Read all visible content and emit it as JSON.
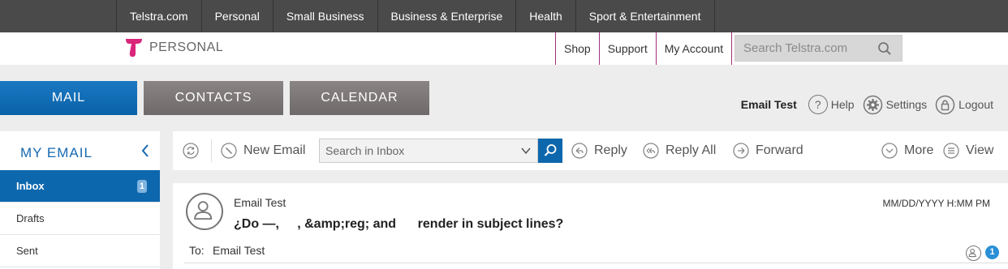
{
  "global_nav": {
    "items": [
      "Telstra.com",
      "Personal",
      "Small Business",
      "Business & Enterprise",
      "Health",
      "Sport & Entertainment"
    ]
  },
  "header": {
    "brand": "PERSONAL",
    "links": [
      "Shop",
      "Support",
      "My Account"
    ],
    "search_placeholder": "Search Telstra.com"
  },
  "tabs": [
    "MAIL",
    "CONTACTS",
    "CALENDAR"
  ],
  "user": {
    "name": "Email Test",
    "help": "Help",
    "settings": "Settings",
    "logout": "Logout"
  },
  "sidebar": {
    "title": "MY EMAIL",
    "items": [
      {
        "label": "Inbox",
        "count": "1"
      },
      {
        "label": "Drafts"
      },
      {
        "label": "Sent"
      }
    ]
  },
  "toolbar": {
    "new_email": "New Email",
    "search_placeholder": "Search in Inbox",
    "reply": "Reply",
    "reply_all": "Reply All",
    "forward": "Forward",
    "more": "More",
    "view": "View"
  },
  "message": {
    "from": "Email Test",
    "date": "MM/DD/YYYY H:MM PM",
    "subject": "¿Do —,     , &amp;reg; and      render in subject lines?",
    "to_label": "To:",
    "to_value": "Email Test",
    "recipient_count": "1"
  },
  "colors": {
    "telstra_blue": "#0d67ad",
    "global_bar": "#4a4a4a",
    "tab_inactive": "#7a7474",
    "accent_magenta": "#a0307a"
  }
}
